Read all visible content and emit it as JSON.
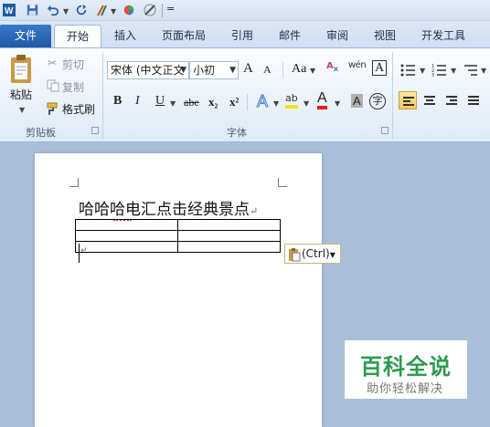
{
  "quick_access": {
    "icons": [
      "word-logo-icon",
      "save-icon",
      "undo-icon",
      "redo-icon",
      "format-painter-icon",
      "color-icon",
      "edit-icon",
      "customize-icon"
    ],
    "customize": "="
  },
  "tabs": [
    "文件",
    "开始",
    "插入",
    "页面布局",
    "引用",
    "邮件",
    "审阅",
    "视图",
    "开发工具"
  ],
  "ribbon": {
    "clipboard": {
      "paste": "粘贴",
      "cut": "剪切",
      "copy": "复制",
      "format_painter": "格式刷",
      "label": "剪贴板"
    },
    "font": {
      "font_name": "宋体 (中文正文",
      "font_size": "小初",
      "grow": "A",
      "shrink": "A",
      "change_case": "Aa",
      "phonetic": "wén",
      "char_border": "A",
      "bold": "B",
      "italic": "I",
      "underline": "U",
      "strike": "abe",
      "subscript": "x₂",
      "superscript": "x²",
      "text_effect": "A",
      "highlight": "ab",
      "font_color": "A",
      "char_shading": "A",
      "enclose": "字",
      "label": "字体"
    }
  },
  "document": {
    "heading": "哈哈哈电汇点击经典景点",
    "paragraph_mark": "↵",
    "table": {
      "rows": 3,
      "cols": 2
    },
    "paste_options": "(Ctrl)"
  },
  "watermark": {
    "title": "百科全说",
    "subtitle": "助你轻松解决"
  },
  "colors": {
    "file_tab": "#2563b0",
    "font_color": "#e02020",
    "highlight": "#f6e21a",
    "watermark": "#2d9a4e"
  }
}
